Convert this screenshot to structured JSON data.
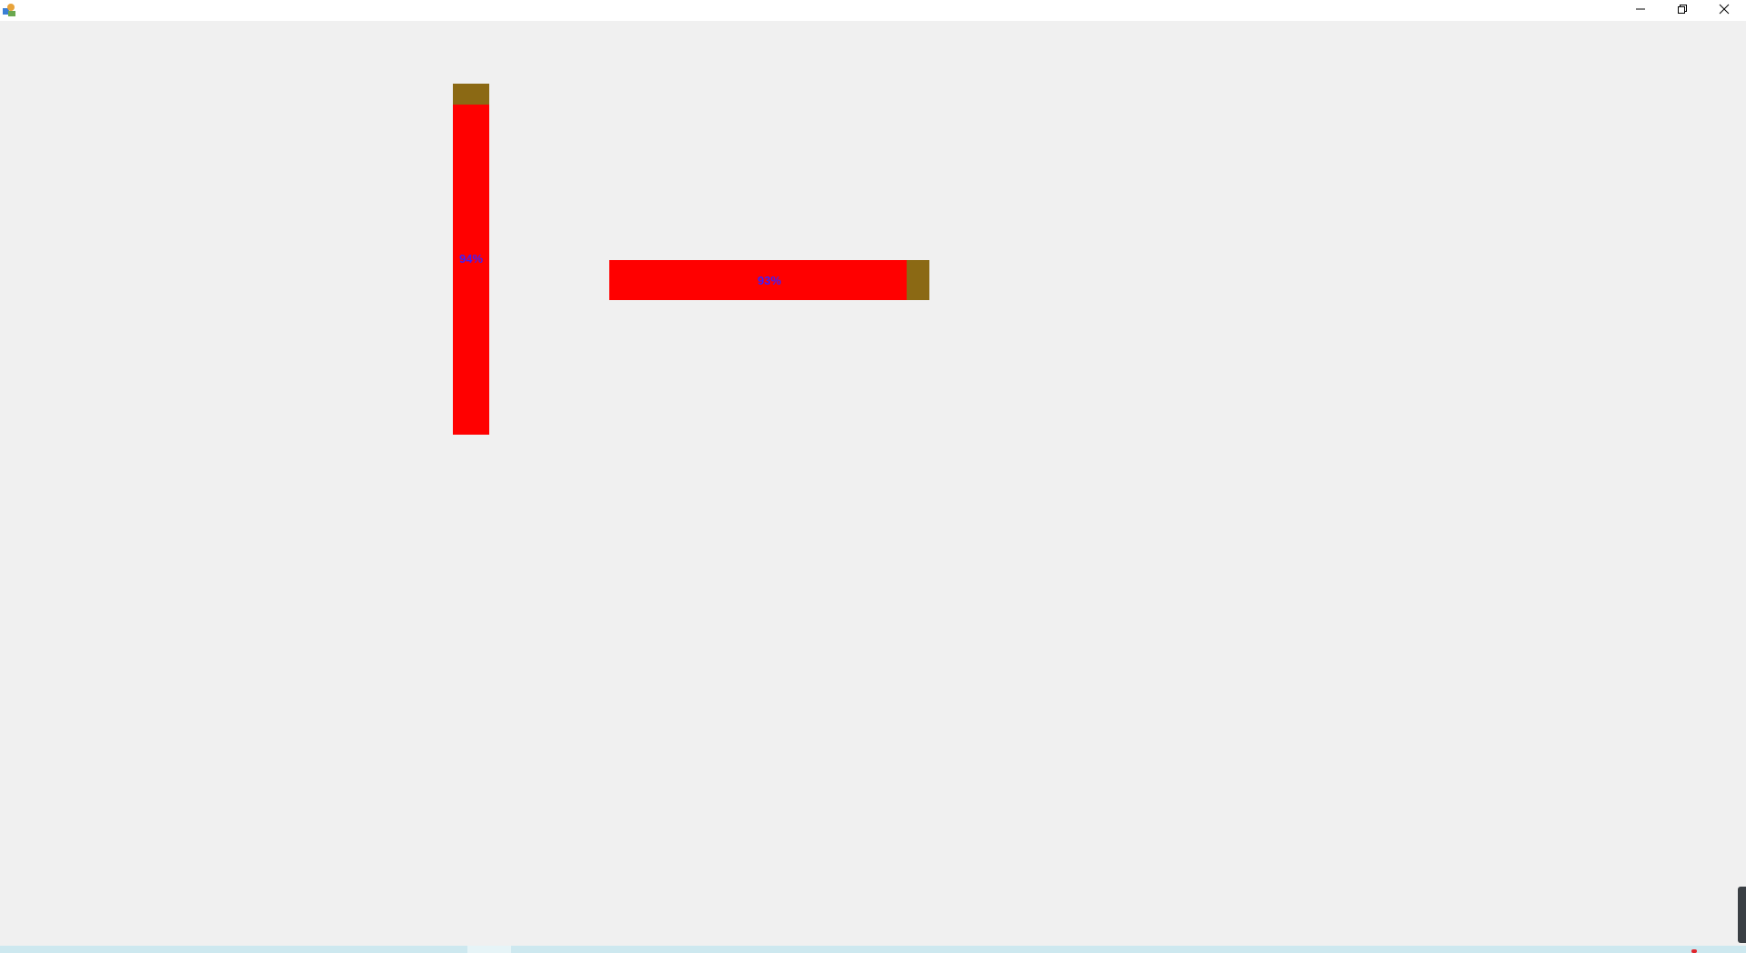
{
  "window": {
    "icon": "java-app-icon",
    "controls": {
      "minimize_icon": "minimize-icon",
      "restore_icon": "restore-icon",
      "close_icon": "close-icon"
    }
  },
  "colors": {
    "fill": "#ff0000",
    "track": "#8b6914",
    "text": "#3a1fff",
    "background": "#f0f0f0"
  },
  "progress_bars": {
    "vertical": {
      "label": "94%",
      "value": 0.94
    },
    "horizontal": {
      "label": "93%",
      "value": 0.93
    }
  }
}
